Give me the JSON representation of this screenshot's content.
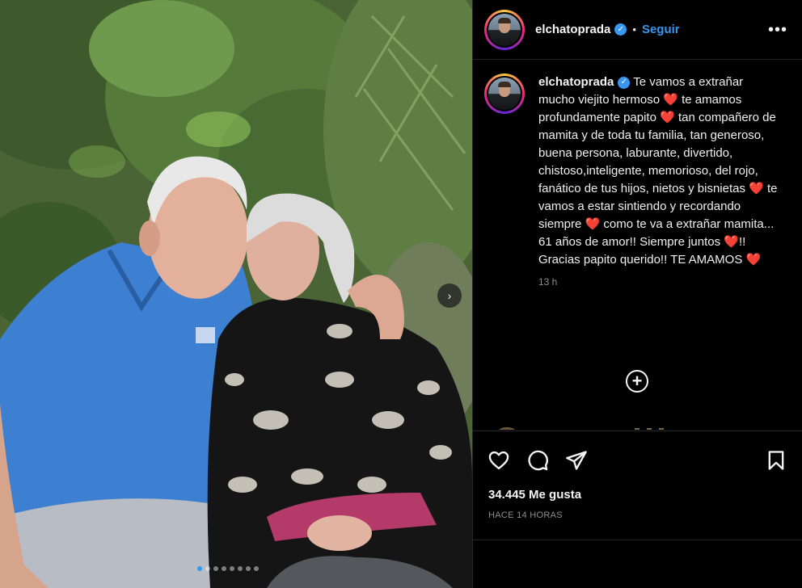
{
  "post": {
    "username": "elchatoprada",
    "verified_mark": "✓",
    "separator": "•",
    "follow_label": "Seguir",
    "more_label": "•••",
    "caption": "Te vamos a extrañar mucho viejito hermoso ❤️ te amamos profundamente papito ❤️ tan compañero de mamita y de toda tu familia, tan generoso, buena persona, laburante, divertido, chistoso,inteligente, memorioso, del rojo, fanático de tus hijos, nietos y bisnietas ❤️ te vamos a estar sintiendo y recordando siempre ❤️ como te va a extrañar mamita... 61 años de amor!! Siempre juntos ❤️!! Gracias papito querido!! TE AMAMOS ❤️",
    "caption_time": "13 h",
    "load_more_icon": "+",
    "likes_text": "34.445 Me gusta",
    "posted_ago": "HACE 14 HORAS"
  },
  "photo": {
    "next_icon": "›",
    "carousel_total": 8,
    "carousel_active": 1
  },
  "icons": [
    "heart-icon",
    "comment-icon",
    "share-icon",
    "bookmark-icon",
    "chevron-right-icon",
    "plus-circle-icon",
    "more-dots-icon",
    "verified-icon"
  ],
  "colors": {
    "background": "#000000",
    "link": "#3897f0",
    "muted": "#8e8e8e",
    "border": "#262626",
    "heart": "#ed4956",
    "shirt_blue": "#3d7fd0"
  }
}
